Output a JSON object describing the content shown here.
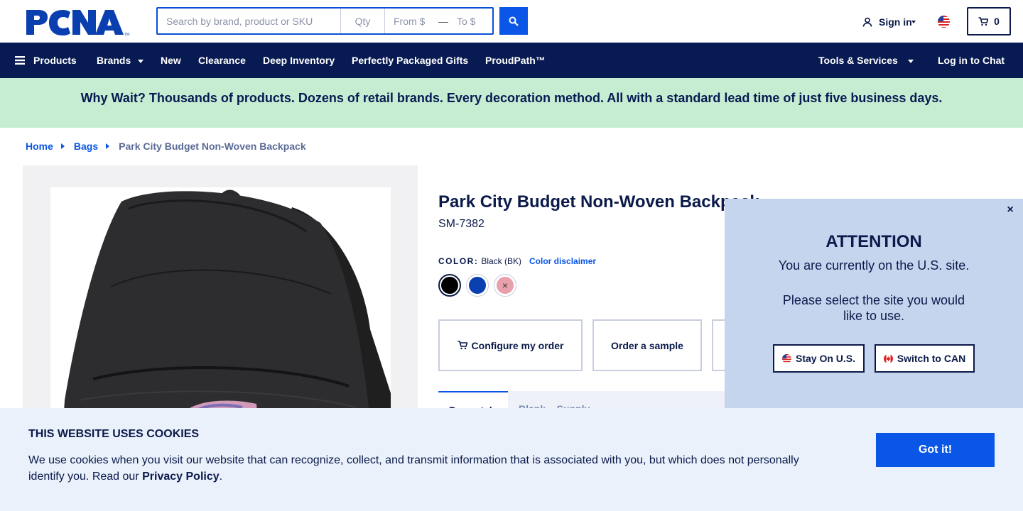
{
  "header": {
    "logo_text": "PCNA",
    "search_placeholder": "Search by brand, product or SKU",
    "qty_placeholder": "Qty",
    "from_placeholder": "From $",
    "to_placeholder": "To $",
    "range_dash": "—",
    "signin_label": "Sign in",
    "cart_count": "0"
  },
  "nav": {
    "products": "Products",
    "brands": "Brands",
    "new": "New",
    "clearance": "Clearance",
    "deep_inventory": "Deep Inventory",
    "gifts": "Perfectly Packaged Gifts",
    "proudpath": "ProudPath™",
    "tools": "Tools & Services",
    "chat": "Log in to Chat"
  },
  "banner": {
    "text": "Why Wait? Thousands of products. Dozens of retail brands. Every decoration method. All with a standard lead time of just five business days."
  },
  "breadcrumb": {
    "home": "Home",
    "bags": "Bags",
    "current": "Park City Budget Non-Woven Backpack"
  },
  "product": {
    "title": "Park City Budget Non-Woven Backpack",
    "sku": "SM-7382",
    "color_label": "COLOR:",
    "color_value": "Black (BK)",
    "color_disclaimer": "Color disclaimer",
    "swatches": [
      {
        "name": "Black",
        "hex": "#000000"
      },
      {
        "name": "Royal Blue",
        "hex": "#0a3fb0"
      },
      {
        "name": "Pink",
        "hex": "#e8a0ac"
      }
    ],
    "configure_label": "Configure my order",
    "sample_label": "Order a sample",
    "tab_partial": "Promotab",
    "tab2_partial": "Blank... Supply"
  },
  "attention": {
    "title": "ATTENTION",
    "line1": "You are currently on the U.S. site.",
    "line2": "Please select the site you would like to use.",
    "stay_label": "Stay On U.S.",
    "switch_label": "Switch to CAN",
    "close_symbol": "×"
  },
  "cookies": {
    "title": "THIS WEBSITE USES COOKIES",
    "text": "We use cookies when you visit our website that can recognize, collect, and transmit information that is associated with you, but which does not personally identify you. Read our",
    "link": "Privacy Policy",
    "period": ".",
    "button": "Got it!"
  },
  "colors": {
    "navy": "#071a52",
    "blue": "#0a56e6",
    "banner_green": "#c6ecd2",
    "popup_bg": "#c5d5ee",
    "cookie_bg": "#eaf1fb"
  }
}
